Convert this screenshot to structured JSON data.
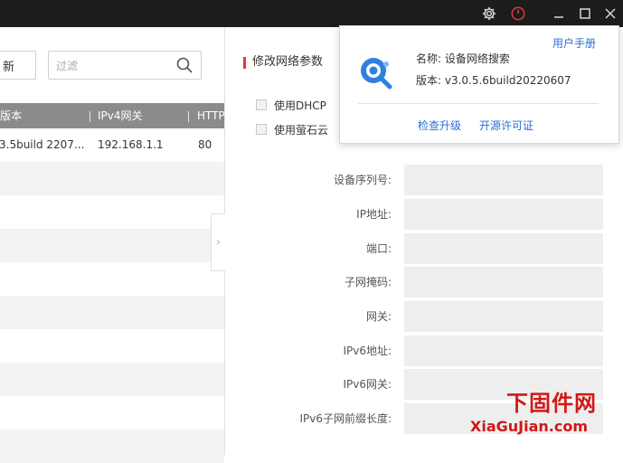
{
  "titlebar": {
    "icons": [
      "gear-icon",
      "power-icon",
      "minimize-icon",
      "maximize-icon",
      "close-icon"
    ],
    "accent": "#e53935"
  },
  "device_list": {
    "refresh_label": "新",
    "filter_placeholder": "过滤",
    "columns": [
      "版本",
      "IPv4网关",
      "HTTP"
    ],
    "rows": [
      {
        "version": "3.5build 2207...",
        "gateway": "192.168.1.1",
        "http": "80"
      }
    ]
  },
  "modify_panel": {
    "title": "修改网络参数",
    "use_dhcp": "使用DHCP",
    "use_ezviz": "使用萤石云",
    "fields": [
      "设备序列号:",
      "IP地址:",
      "端口:",
      "子网掩码:",
      "网关:",
      "IPv6地址:",
      "IPv6网关:",
      "IPv6子网前缀长度:"
    ]
  },
  "about_popup": {
    "manual_link": "用户手册",
    "name_line": "名称:  设备网络搜索",
    "version_line": "版本:  v3.0.5.6build20220607",
    "check_update": "检查升级",
    "open_source": "开源许可证"
  },
  "watermark": {
    "cn": "下固件网",
    "en": "XiaGuJian.com"
  },
  "colors": {
    "link": "#2a6fd6",
    "header_bg": "#8b8b8b",
    "section_bar": "#e03a3a",
    "watermark": "#d01818"
  }
}
